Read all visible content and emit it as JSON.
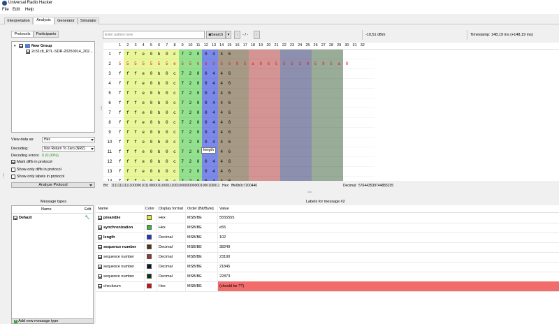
{
  "window": {
    "title": "Universal Radio Hacker"
  },
  "menu": [
    "File",
    "Edit",
    "Help"
  ],
  "tabs": [
    "Interpretation",
    "Analysis",
    "Generator",
    "Simulator"
  ],
  "left": {
    "subtabs": [
      "Protocols",
      "Participants"
    ],
    "tree": {
      "group": "New Group",
      "item": "2c31c8_RTL-SDR-20250914_202..."
    },
    "view_data_as_label": "View data as:",
    "view_data_as_value": "Hex",
    "decoding_label": "Decoding:",
    "decoding_value": "Non Return To Zero (NRZ)",
    "decoding_errors_label": "Decoding errors:",
    "decoding_errors_value": "0 (0,00%)",
    "mark_diffs": "Mark diffs in protocol",
    "show_only_diffs": "Show only diffs in protocol",
    "show_only_labels": "Show only labels in protocol",
    "analyze_button": "Analyze Protocol"
  },
  "toolbar": {
    "pattern_placeholder": "Enter pattern here",
    "search_button": "Search",
    "nav_text": "- / -",
    "dbm": "-10,51 dBm",
    "timestamp": "Timestamp: 148,19 ms (+148,19 ms)"
  },
  "grid": {
    "columns": [
      "1",
      "2",
      "3",
      "4",
      "5",
      "6",
      "7",
      "8",
      "9",
      "10",
      "11",
      "12",
      "13",
      "14",
      "15",
      "16",
      "17",
      "18",
      "19",
      "20",
      "21",
      "22",
      "23",
      "24",
      "25",
      "26",
      "27",
      "28",
      "29",
      "30",
      "31",
      "32"
    ],
    "row_numbers": [
      "1",
      "2",
      "3",
      "4",
      "5",
      "6",
      "7",
      "8",
      "9",
      "10",
      "11",
      "12",
      "13",
      "14"
    ],
    "normal_row": [
      "f",
      "f",
      "f",
      "e",
      "0",
      "b",
      "0",
      "c",
      "7",
      "2",
      "0",
      "0",
      "4",
      "4",
      "6"
    ],
    "row2": [
      "5",
      "5",
      "5",
      "5",
      "5",
      "5",
      "5",
      "e",
      "5",
      "5",
      "6",
      "6",
      "9",
      "5",
      "6",
      "9",
      "5",
      "a",
      "9",
      "6",
      "5",
      "5",
      "5",
      "3",
      "9",
      "5",
      "9",
      "5",
      "a",
      "8"
    ],
    "tooltip": "length"
  },
  "status": {
    "bit_label": "Bit:",
    "bit_value": "1111111111110000010110000011000111001000000000001000100011",
    "hex_label": "Hex:",
    "hex_value": "fffe0b0c7200446",
    "decimal_label": "Decimal:",
    "decimal_value": "576443539744883235"
  },
  "message_types": {
    "title": "Message types",
    "col_name": "Name",
    "col_edit": "Edit",
    "default": "Default",
    "add_button": "Add new message type"
  },
  "labels": {
    "title": "Labels for message #2",
    "columns": [
      "Name",
      "Color",
      "Display format",
      "Order [Bit/Byte]",
      "Value"
    ],
    "rows": [
      {
        "name": "preamble",
        "bold": true,
        "color": "#e8e820",
        "format": "Hex",
        "order": "MSB/BE",
        "value": "5555555"
      },
      {
        "name": "synchronization",
        "bold": true,
        "color": "#33bb44",
        "format": "Hex",
        "order": "MSB/BE",
        "value": "e55"
      },
      {
        "name": "length",
        "bold": true,
        "color": "#2233cc",
        "format": "Decimal",
        "order": "MSB/BE",
        "value": "102"
      },
      {
        "name": "sequence number",
        "bold": true,
        "color": "#553311",
        "format": "Decimal",
        "order": "MSB/BE",
        "value": "38249"
      },
      {
        "name": "sequence number",
        "bold": false,
        "color": "#993333",
        "format": "Decimal",
        "order": "MSB/BE",
        "value": "23190"
      },
      {
        "name": "sequence number",
        "bold": false,
        "color": "#111133",
        "format": "Decimal",
        "order": "MSB/BE",
        "value": "21845"
      },
      {
        "name": "sequence number",
        "bold": false,
        "color": "#113311",
        "format": "Decimal",
        "order": "MSB/BE",
        "value": "22873"
      },
      {
        "name": "checksum",
        "bold": false,
        "color": "#cc1111",
        "format": "Hex",
        "order": "MSB/BE",
        "value": "(should be ??)"
      }
    ]
  },
  "colors": {
    "preamble": "#e9f79a",
    "sync": "#93e08f",
    "length": "#7b8ae8",
    "seq1": "#a69a86",
    "seq2": "#d49494",
    "seq3": "#8c8fae",
    "seq4": "#98ac98",
    "checksum_bad": "#f26c6c"
  }
}
